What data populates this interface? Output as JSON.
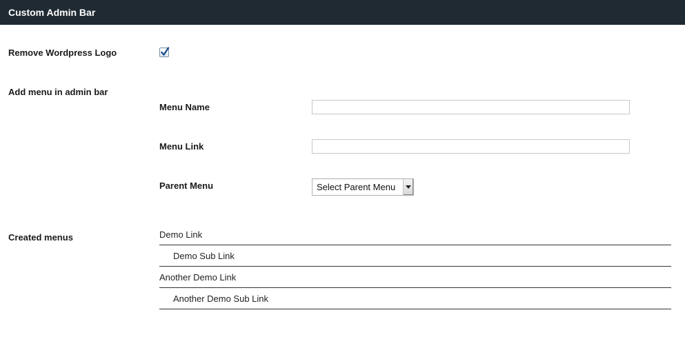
{
  "header": {
    "title": "Custom Admin Bar"
  },
  "remove_logo": {
    "label": "Remove Wordpress Logo",
    "checked": true
  },
  "add_menu": {
    "label": "Add menu in admin bar",
    "menu_name": {
      "label": "Menu Name",
      "value": ""
    },
    "menu_link": {
      "label": "Menu Link",
      "value": ""
    },
    "parent_menu": {
      "label": "Parent Menu",
      "selected": "Select Parent Menu"
    }
  },
  "created_menus": {
    "label": "Created menus",
    "items": [
      {
        "label": "Demo Link",
        "level": 0
      },
      {
        "label": "Demo Sub Link",
        "level": 1
      },
      {
        "label": "Another Demo Link",
        "level": 0
      },
      {
        "label": "Another Demo Sub Link",
        "level": 1
      }
    ]
  },
  "colors": {
    "header_bg": "#1f2a33",
    "header_text": "#ffffff",
    "divider": "#333333"
  }
}
